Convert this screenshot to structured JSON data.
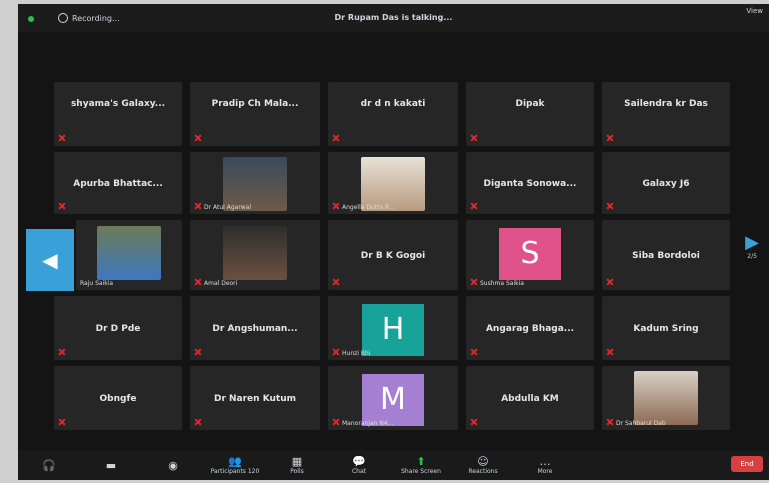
{
  "topbar": {
    "recording": "Recording...",
    "title": "Dr Rupam Das is talking...",
    "view": "View"
  },
  "tiles": [
    {
      "name": "shyama's Galaxy..."
    },
    {
      "name": "Pradip Ch Mala..."
    },
    {
      "name": "dr d n kakati"
    },
    {
      "name": "Dipak"
    },
    {
      "name": "Sailendra kr Das"
    },
    {
      "name": "Apurba Bhattac..."
    },
    {
      "caption": "Dr Atul Agarwal"
    },
    {
      "caption": "Angella Dutta R..."
    },
    {
      "name": "Diganta Sonowa..."
    },
    {
      "name": "Galaxy J6"
    },
    {
      "caption": "Raju Saikia"
    },
    {
      "caption": "Amal Deori"
    },
    {
      "name": "Dr B K Gogoi"
    },
    {
      "avatar": "S",
      "avatar_color": "#e0528a",
      "caption": "Sushma Saikia"
    },
    {
      "name": "Siba Bordoloi"
    },
    {
      "name": "Dr D Pde"
    },
    {
      "name": "Dr Angshuman..."
    },
    {
      "avatar": "H",
      "avatar_color": "#18a39a",
      "caption": "Hunzi Bhi"
    },
    {
      "name": "Angarag Bhaga..."
    },
    {
      "name": "Kadum Sring"
    },
    {
      "name": "Obngfe"
    },
    {
      "name": "Dr Naren Kutum"
    },
    {
      "avatar": "M",
      "avatar_color": "#a57fd2",
      "caption": "Manoranjan N4..."
    },
    {
      "name": "Abdulla KM"
    },
    {
      "caption": "Dr Sahbarul Dab"
    }
  ],
  "nav": {
    "right_page": "2/5"
  },
  "toolbar": [
    {
      "label": "",
      "icon": "headphones-icon"
    },
    {
      "label": "",
      "icon": "video-icon"
    },
    {
      "label": "",
      "icon": "security-icon"
    },
    {
      "label": "Participants",
      "icon": "participants-icon",
      "count": "120"
    },
    {
      "label": "Polls",
      "icon": "polls-icon"
    },
    {
      "label": "Chat",
      "icon": "chat-icon"
    },
    {
      "label": "Share Screen",
      "icon": "share-screen-icon"
    },
    {
      "label": "Reactions",
      "icon": "reactions-icon"
    },
    {
      "label": "More",
      "icon": "more-icon"
    }
  ],
  "end": "End"
}
